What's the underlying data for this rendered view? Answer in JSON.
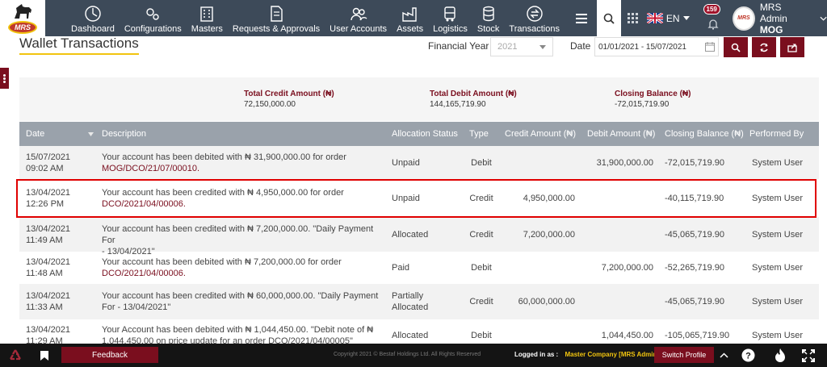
{
  "nav": {
    "logo_text": "MRS",
    "items": [
      {
        "label": "Dashboard",
        "icon": "dashboard-icon"
      },
      {
        "label": "Configurations",
        "icon": "gears-icon"
      },
      {
        "label": "Masters",
        "icon": "building-icon"
      },
      {
        "label": "Requests & Approvals",
        "icon": "document-icon"
      },
      {
        "label": "User Accounts",
        "icon": "users-icon"
      },
      {
        "label": "Assets",
        "icon": "factory-icon"
      },
      {
        "label": "Logistics",
        "icon": "truck-icon"
      },
      {
        "label": "Stock",
        "icon": "database-icon"
      },
      {
        "label": "Transactions",
        "icon": "exchange-icon"
      }
    ],
    "lang": "EN",
    "notification_count": "159",
    "user_name": "MRS Admin",
    "user_org": "MOG",
    "avatar_text": "MRS"
  },
  "header": {
    "title": "Wallet Transactions",
    "fy_label": "Financial Year",
    "fy_value": "2021",
    "date_label": "Date",
    "date_value": "01/01/2021 - 15/07/2021"
  },
  "summary": {
    "credit_title": "Total Credit Amount (₦)",
    "credit_value": "72,150,000.00",
    "debit_title": "Total Debit Amount (₦)",
    "debit_value": "144,165,719.90",
    "closing_title": "Closing Balance (₦)",
    "closing_value": "-72,015,719.90"
  },
  "table": {
    "headers": {
      "date": "Date",
      "description": "Description",
      "allocation": "Allocation Status",
      "type": "Type",
      "credit": "Credit Amount (₦)",
      "debit": "Debit Amount (₦)",
      "closing": "Closing Balance (₦)",
      "performed": "Performed By"
    },
    "rows": [
      {
        "date": "15/07/2021",
        "time": "09:02 AM",
        "desc1": "Your account has been debited with ₦ 31,900,000.00 for order",
        "desc2": "MOG/DCO/21/07/00010.",
        "desc2_link": true,
        "alloc": "Unpaid",
        "type": "Debit",
        "credit": "",
        "debit": "31,900,000.00",
        "closing": "-72,015,719.90",
        "by": "System User"
      },
      {
        "date": "13/04/2021",
        "time": "12:26 PM",
        "desc1": "Your account has been credited with ₦ 4,950,000.00 for order",
        "desc2": "DCO/2021/04/00006.",
        "desc2_link": true,
        "alloc": "Unpaid",
        "type": "Credit",
        "credit": "4,950,000.00",
        "debit": "",
        "closing": "-40,115,719.90",
        "by": "System User"
      },
      {
        "date": "13/04/2021",
        "time": "11:49 AM",
        "desc1": "Your account has been credited with ₦ 7,200,000.00. \"Daily Payment For",
        "desc2": "- 13/04/2021\"",
        "desc2_link": false,
        "alloc": "Allocated",
        "type": "Credit",
        "credit": "7,200,000.00",
        "debit": "",
        "closing": "-45,065,719.90",
        "by": "System User"
      },
      {
        "date": "13/04/2021",
        "time": "11:48 AM",
        "desc1": "Your account has been debited with ₦ 7,200,000.00 for order",
        "desc2": "DCO/2021/04/00006.",
        "desc2_link": true,
        "alloc": "Paid",
        "type": "Debit",
        "credit": "",
        "debit": "7,200,000.00",
        "closing": "-52,265,719.90",
        "by": "System User"
      },
      {
        "date": "13/04/2021",
        "time": "11:33 AM",
        "desc1": "Your account has been credited with ₦ 60,000,000.00. \"Daily Payment",
        "desc2": "For - 13/04/2021\"",
        "desc2_link": false,
        "alloc": "Partially",
        "alloc2": "Allocated",
        "type": "Credit",
        "credit": "60,000,000.00",
        "debit": "",
        "closing": "-45,065,719.90",
        "by": "System User"
      },
      {
        "date": "13/04/2021",
        "time": "11:29 AM",
        "desc1": "Your Account has been debited with ₦ 1,044,450.00. \"Debit note of ₦",
        "desc2": "1,044,450.00 on price update for an order DCO/2021/04/00005\"",
        "desc2_link": false,
        "alloc": "Allocated",
        "type": "Debit",
        "credit": "",
        "debit": "1,044,450.00",
        "closing": "-105,065,719.90",
        "by": "System User"
      }
    ]
  },
  "footer": {
    "feedback": "Feedback",
    "copyright": "Copyright 2021 © Bestaf Holdings Ltd. All Rights Reserved",
    "logged_label": "Logged in as :",
    "logged_company": "Master Company [MRS Admin]",
    "switch_profile": "Switch Profile"
  },
  "colors": {
    "nav_bg": "#3d4a59",
    "accent": "#7a0e1e",
    "header_bg": "#9aa2ab",
    "highlight": "#e00000"
  }
}
